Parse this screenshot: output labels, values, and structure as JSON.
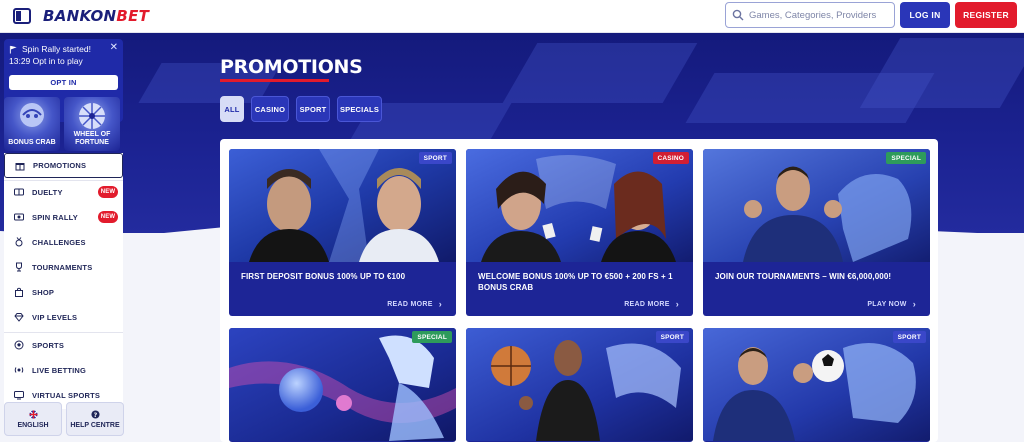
{
  "header": {
    "logo_primary": "BANKON",
    "logo_accent": "BET",
    "search_placeholder": "Games, Categories, Providers",
    "login_label": "LOG IN",
    "register_label": "REGISTER"
  },
  "sidebar": {
    "rally": {
      "title": "Spin Rally started!",
      "subtitle": "13:29 Opt in to play",
      "optin_label": "OPT IN",
      "close_glyph": "✕"
    },
    "tiles": [
      {
        "label": "BONUS CRAB"
      },
      {
        "label": "WHEEL OF FORTUNE"
      }
    ],
    "nav": [
      {
        "label": "PROMOTIONS",
        "icon": "gift-icon",
        "active": true
      },
      {
        "label": "DUELTY",
        "icon": "duel-icon",
        "badge": "NEW"
      },
      {
        "label": "SPIN RALLY",
        "icon": "rally-icon",
        "badge": "NEW"
      },
      {
        "label": "CHALLENGES",
        "icon": "medal-icon"
      },
      {
        "label": "TOURNAMENTS",
        "icon": "trophy-icon"
      },
      {
        "label": "SHOP",
        "icon": "bag-icon"
      },
      {
        "label": "VIP LEVELS",
        "icon": "diamond-icon"
      },
      {
        "label": "SPORTS",
        "icon": "ball-icon"
      },
      {
        "label": "LIVE BETTING",
        "icon": "live-icon"
      },
      {
        "label": "VIRTUAL SPORTS",
        "icon": "virtual-icon"
      }
    ],
    "language_label": "ENGLISH",
    "help_label": "HELP CENTRE"
  },
  "main": {
    "title": "PROMOTIONS",
    "filters": [
      {
        "label": "ALL",
        "active": true
      },
      {
        "label": "CASINO"
      },
      {
        "label": "SPORT"
      },
      {
        "label": "SPECIALS"
      }
    ],
    "cards": [
      {
        "tag": "SPORT",
        "tag_type": "sport",
        "title": "FIRST DEPOSIT BONUS 100% UP TO €100",
        "cta": "READ MORE"
      },
      {
        "tag": "CASINO",
        "tag_type": "casino",
        "title": "WELCOME BONUS 100% UP TO €500 + 200 FS + 1 BONUS CRAB",
        "cta": "READ MORE"
      },
      {
        "tag": "SPECIAL",
        "tag_type": "special",
        "title": "JOIN OUR TOURNAMENTS – WIN €6,000,000!",
        "cta": "PLAY NOW"
      },
      {
        "tag": "SPECIAL",
        "tag_type": "special",
        "title": "",
        "cta": ""
      },
      {
        "tag": "SPORT",
        "tag_type": "sport",
        "title": "",
        "cta": ""
      },
      {
        "tag": "SPORT",
        "tag_type": "sport",
        "title": "",
        "cta": ""
      }
    ]
  },
  "colors": {
    "brand_blue": "#1a1f7a",
    "brand_red": "#e21b2c",
    "hero_blue": "#1c2393",
    "accent_blue": "#2a36b8"
  }
}
